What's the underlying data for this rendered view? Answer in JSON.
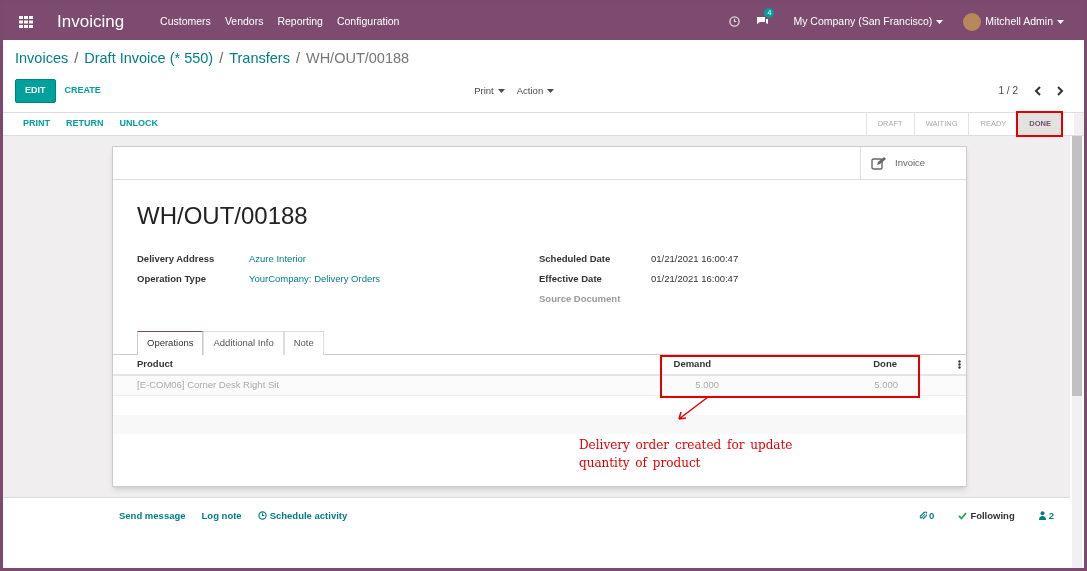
{
  "navbar": {
    "brand": "Invoicing",
    "menus": [
      "Customers",
      "Vendors",
      "Reporting",
      "Configuration"
    ],
    "messages_badge": "4",
    "company": "My Company (San Francisco)",
    "user": "Mitchell Admin"
  },
  "breadcrumb_separator": "/",
  "breadcrumbs": [
    {
      "label": "Invoices",
      "current": false
    },
    {
      "label": "Draft Invoice (* 550)",
      "current": false
    },
    {
      "label": "Transfers",
      "current": false
    },
    {
      "label": "WH/OUT/00188",
      "current": true
    }
  ],
  "control_panel": {
    "edit": "EDIT",
    "create": "CREATE",
    "print": "Print",
    "action": "Action",
    "pager": "1 / 2"
  },
  "header_buttons": [
    "PRINT",
    "RETURN",
    "UNLOCK"
  ],
  "statuses": [
    {
      "label": "DRAFT",
      "selected": false
    },
    {
      "label": "WAITING",
      "selected": false
    },
    {
      "label": "READY",
      "selected": false
    },
    {
      "label": "DONE",
      "selected": true
    }
  ],
  "form": {
    "smart_button": "Invoice",
    "title": "WH/OUT/00188",
    "left_fields": [
      {
        "label": "Delivery Address",
        "value": "Azure Interior"
      },
      {
        "label": "Operation Type",
        "value": "YourCompany: Delivery Orders"
      }
    ],
    "right_fields": [
      {
        "label": "Scheduled Date",
        "value": "01/21/2021 16:00:47"
      },
      {
        "label": "Effective Date",
        "value": "01/21/2021 16:00:47"
      },
      {
        "label": "Source Document"
      }
    ],
    "tabs": [
      {
        "label": "Operations",
        "selected": true
      },
      {
        "label": "Additional Info",
        "selected": false
      },
      {
        "label": "Note",
        "selected": false
      }
    ],
    "table": {
      "columns": [
        "Product",
        "Demand",
        "Done"
      ],
      "rows": [
        {
          "product": "[E-COM06] Corner Desk Right Sit",
          "demand": "5.000",
          "done": "5.000"
        }
      ]
    }
  },
  "annotation": {
    "text": "Delivery order created for update quantity of product"
  },
  "chatter": {
    "send_message": "Send message",
    "log_note": "Log note",
    "schedule_activity": "Schedule activity",
    "attachments": "0",
    "following": "Following",
    "followers": "2"
  }
}
